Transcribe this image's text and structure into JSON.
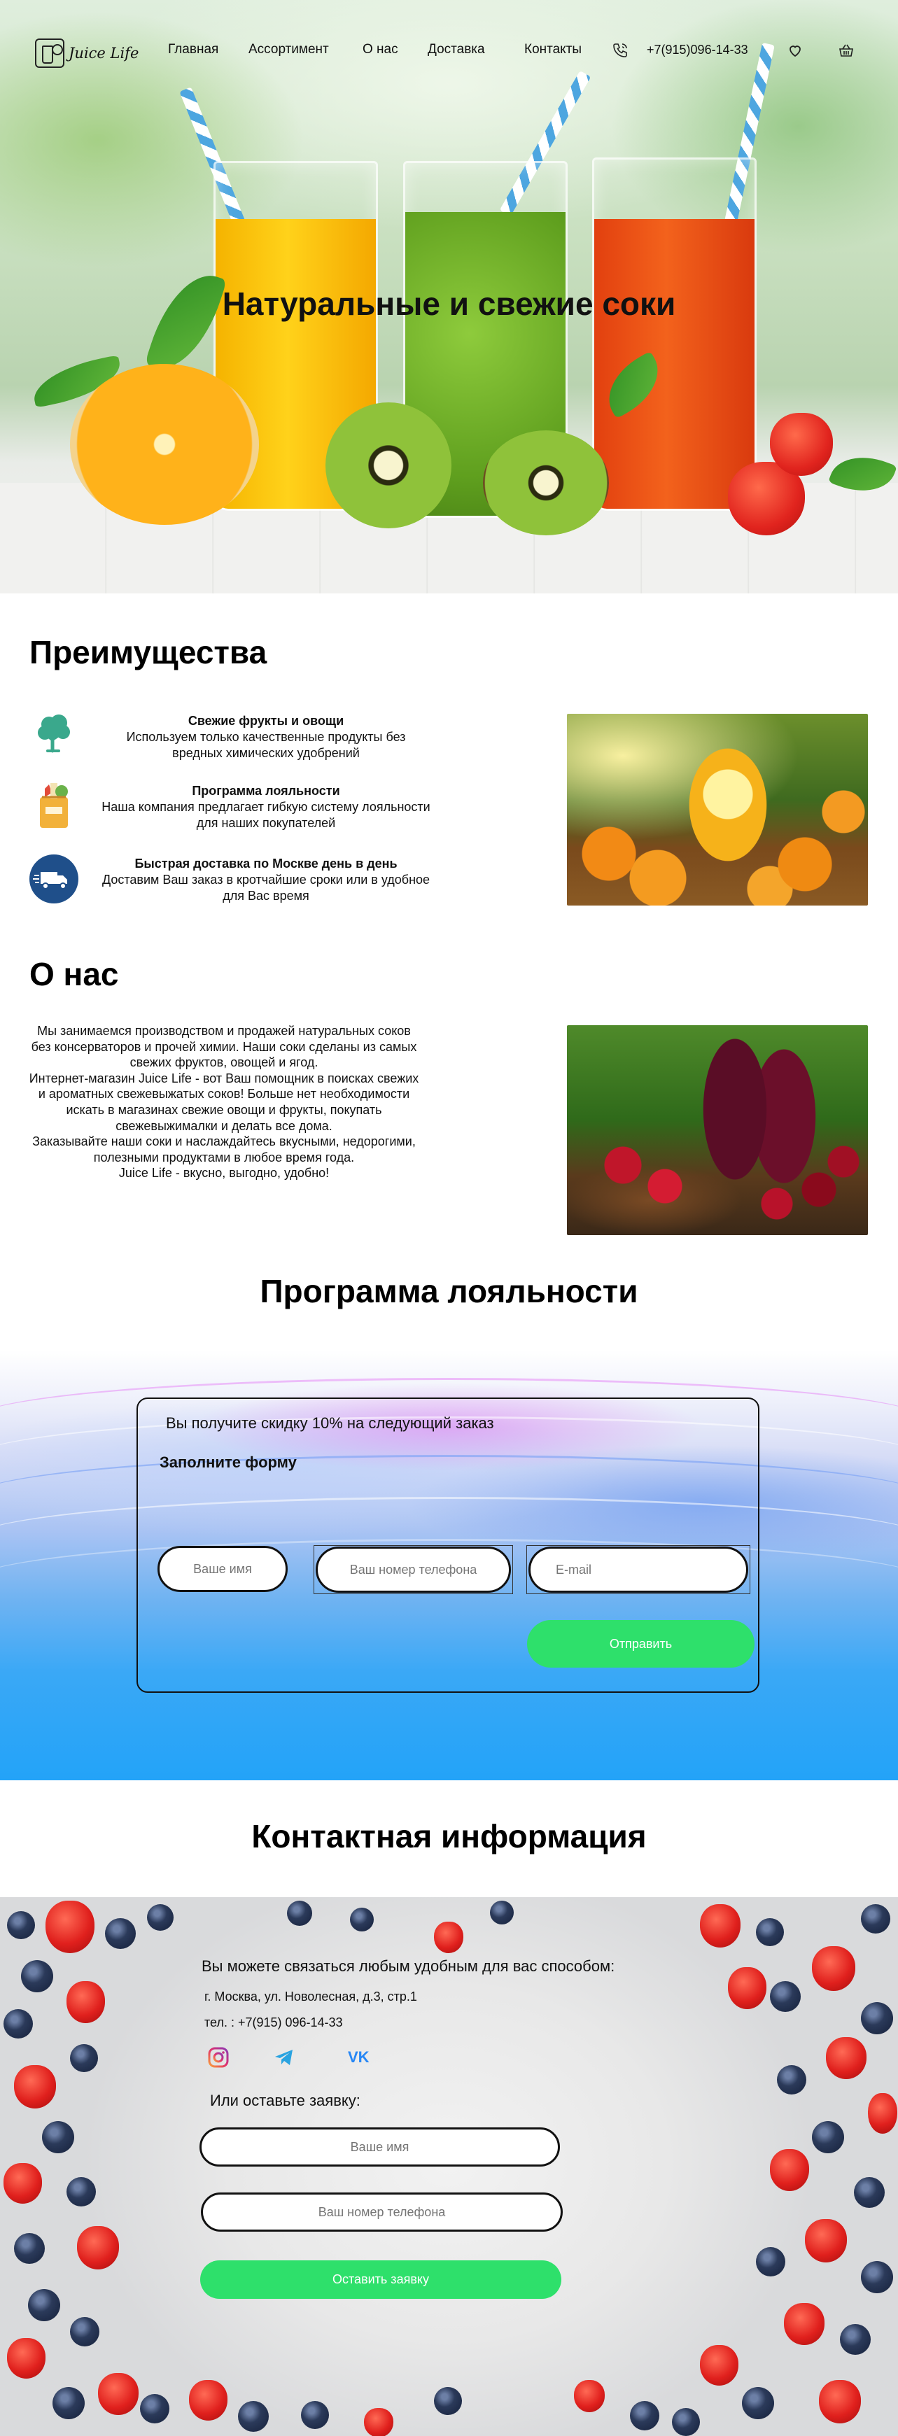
{
  "brand": {
    "name": "Juice Life",
    "logo_icon": "juice-glass-logo-icon"
  },
  "nav": {
    "items": [
      {
        "label": "Главная"
      },
      {
        "label": "Ассортимент"
      },
      {
        "label": "О нас"
      },
      {
        "label": "Доставка"
      },
      {
        "label": "Контакты"
      }
    ],
    "phone": "+7(915)096-14-33",
    "icons": [
      "phone-icon",
      "heart-icon",
      "basket-icon"
    ]
  },
  "hero": {
    "title": "Натуральные и свежие соки"
  },
  "advantages": {
    "title": "Преимущества",
    "items": [
      {
        "icon": "tree-icon",
        "title": "Свежие фрукты и овощи",
        "text": "Используем только качественные продукты без вредных химических удобрений"
      },
      {
        "icon": "grocery-bag-icon",
        "title": "Программа лояльности",
        "text": "Наша компания предлагает гибкую систему лояльности для наших покупателей"
      },
      {
        "icon": "delivery-truck-icon",
        "title": "Быстрая доставка по Москве день в день",
        "text": "Доставим Ваш заказ в кротчайшие сроки или в удобное для Вас время"
      }
    ]
  },
  "about": {
    "title": "О нас",
    "paragraphs": [
      "Мы занимаемся производством и продажей натуральных соков без консерваторов и прочей химии. Наши соки сделаны из самых свежих фруктов, овощей и ягод.",
      "Интернет-магазин Juice Life - вот Ваш помощник в поисках свежих и ароматных свежевыжатых соков! Больше нет необходимости искать в магазинах свежие овощи и фрукты, покупать свежевыжималки и делать все дома.",
      "Заказывайте наши соки и наслаждайтесь вкусными, недорогими, полезными продуктами в любое время года.",
      "Juice Life - вкусно, выгодно, удобно!"
    ]
  },
  "loyalty": {
    "title": "Программа лояльности",
    "offer": "Вы получите скидку 10% на следующий заказ",
    "form_title": "Заполните форму",
    "name_placeholder": "Ваше имя",
    "phone_placeholder": "Ваш номер телефона",
    "email_placeholder": "E-mail",
    "submit_label": "Отправить"
  },
  "contacts": {
    "title": "Контактная информация",
    "intro": "Вы можете связаться любым удобным для вас способом:",
    "address": "г. Москва, ул. Новолесная, д.3, стр.1",
    "phone": "тел. : +7(915) 096-14-33",
    "socials": [
      "instagram-icon",
      "telegram-icon",
      "vk-icon"
    ],
    "social_vk_text": "VK",
    "or_text": "Или оставьте заявку:",
    "name_placeholder": "Ваше имя",
    "phone_placeholder": "Ваш номер телефона",
    "submit_label": "Оставить заявку"
  },
  "colors": {
    "accent_green": "#2ee06b",
    "icon_teal": "#3aa88c",
    "icon_navy": "#1f4f8a",
    "text": "#111111"
  }
}
